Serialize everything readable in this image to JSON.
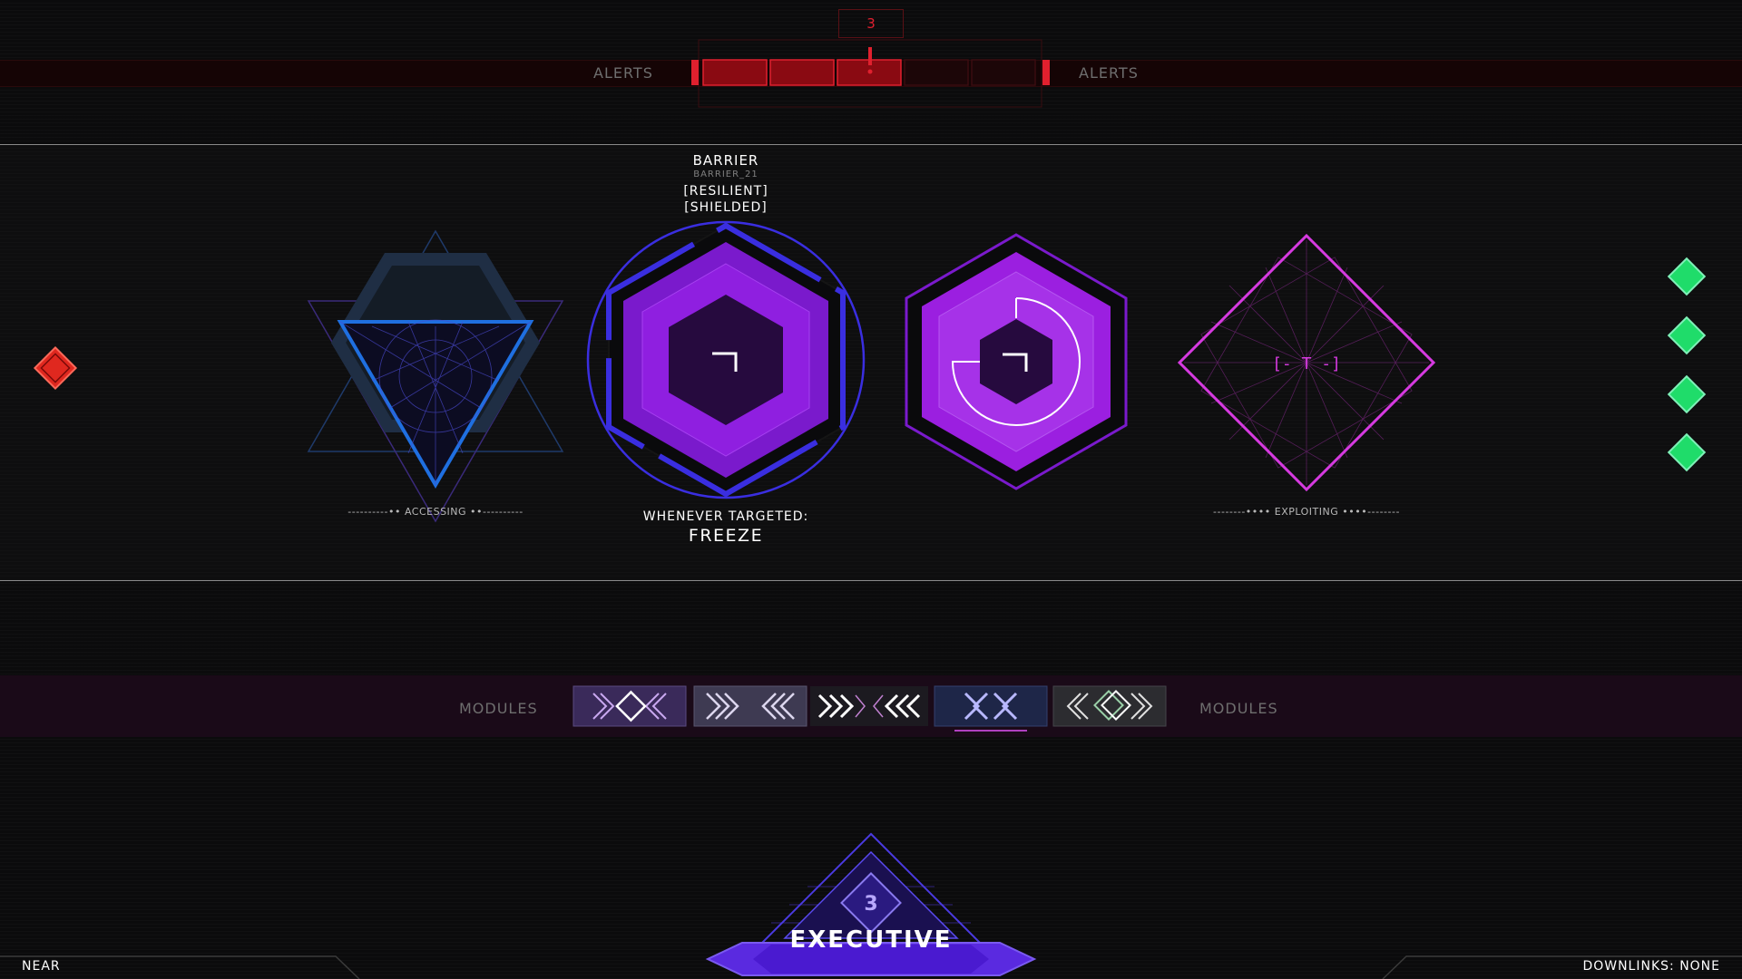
{
  "alerts": {
    "left_label": "ALERTS",
    "right_label": "ALERTS",
    "count": "3",
    "filled_segments": 3,
    "total_segments": 5,
    "color": "#e0202e"
  },
  "nodes": {
    "accessing": {
      "caption": "ACCESSING",
      "icon": "triangle-node-icon"
    },
    "barrier": {
      "title": "BARRIER",
      "id": "BARRIER_21",
      "tags": [
        "[RESILIENT]",
        "[SHIELDED]"
      ],
      "trigger_label": "WHENEVER TARGETED:",
      "trigger_effect": "FREEZE",
      "icon": "hexagon-barrier-icon"
    },
    "progress": {
      "icon": "hexagon-progress-icon",
      "progress_fraction": 0.75
    },
    "exploiting": {
      "caption": "EXPLOITING",
      "glyph": "[- T -]",
      "icon": "diamond-node-icon"
    }
  },
  "modules": {
    "left_label": "MODULES",
    "right_label": "MODULES",
    "items": [
      {
        "icon": "module-chevron-diamond-icon"
      },
      {
        "icon": "module-double-chevron-icon"
      },
      {
        "icon": "module-arrow-burst-icon"
      },
      {
        "icon": "module-x-chevron-icon",
        "selected": true
      },
      {
        "icon": "module-grey-diamond-icon"
      }
    ]
  },
  "side_indicators": {
    "left": [
      {
        "icon": "red-diamond-icon",
        "color": "#e0281f"
      }
    ],
    "right": [
      {
        "icon": "green-diamond-icon",
        "color": "#1fdc6a"
      },
      {
        "icon": "green-diamond-icon",
        "color": "#1fdc6a"
      },
      {
        "icon": "green-diamond-icon",
        "color": "#1fdc6a"
      },
      {
        "icon": "green-diamond-icon",
        "color": "#1fdc6a"
      }
    ]
  },
  "footer": {
    "left_label": "NEAR",
    "right_label": "DOWNLINKS: NONE",
    "rank_label": "EXECUTIVE",
    "rank_glyph": "3"
  },
  "colors": {
    "purple": "#9b1fe0",
    "violet": "#7a1acc",
    "magenta": "#d63ae0",
    "blue": "#3a2ee0",
    "accent_blue": "#1f6fe0"
  }
}
